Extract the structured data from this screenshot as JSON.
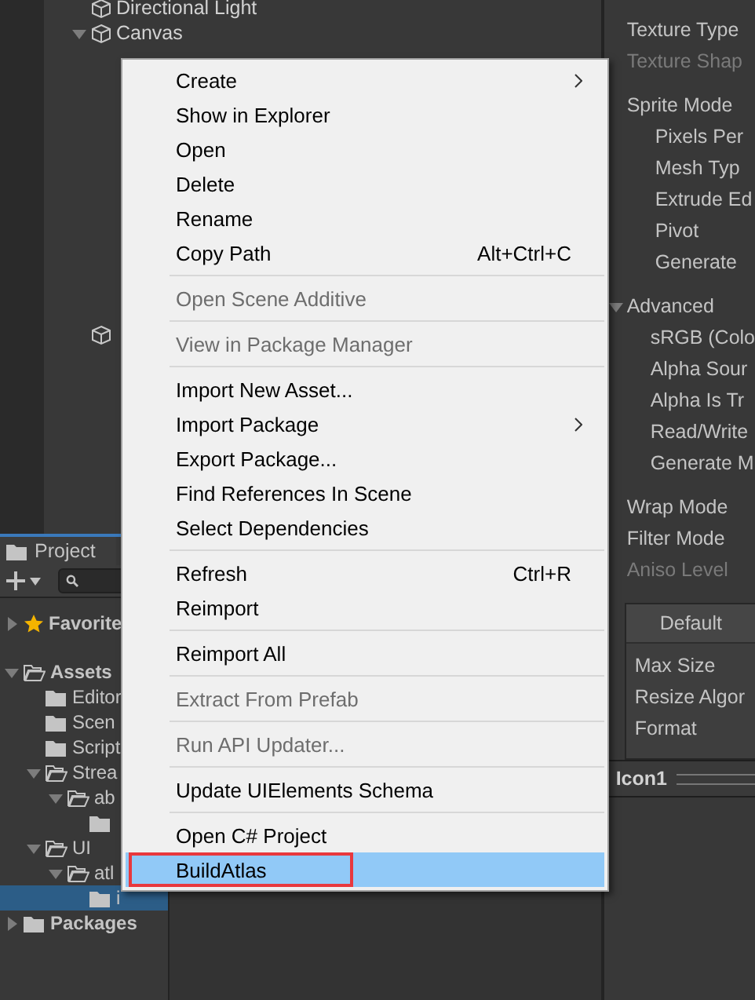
{
  "hierarchy": {
    "items": [
      {
        "kind": "object",
        "name": "Directional Light",
        "selected": false
      },
      {
        "kind": "object",
        "name": "Canvas",
        "selected": false,
        "expanded": true
      },
      {
        "kind": "object",
        "selected": false
      }
    ]
  },
  "project": {
    "tab": "Project",
    "tree": [
      {
        "kind": "favorites",
        "name": "Favorite",
        "expanded": false,
        "selected": false
      },
      {
        "kind": "folder",
        "name": "Assets",
        "expanded": true,
        "selected": false,
        "children": [
          {
            "kind": "folder",
            "name": "Editor",
            "selected": false
          },
          {
            "kind": "folder",
            "name": "Scen",
            "selected": false
          },
          {
            "kind": "folder",
            "name": "Script",
            "selected": false
          },
          {
            "kind": "folder",
            "name": "Strea",
            "expanded": true,
            "selected": false,
            "children": [
              {
                "kind": "folder",
                "name": "ab",
                "expanded": true,
                "selected": false,
                "children": [
                  {
                    "kind": "folder",
                    "selected": false
                  }
                ]
              }
            ]
          },
          {
            "kind": "folder",
            "name": "UI",
            "expanded": true,
            "selected": false,
            "children": [
              {
                "kind": "folder",
                "name": "atl",
                "expanded": true,
                "selected": false,
                "children": [
                  {
                    "kind": "folder",
                    "name": "i",
                    "selected": true
                  }
                ]
              }
            ]
          }
        ]
      },
      {
        "kind": "folder",
        "name": "Packages",
        "expanded": false,
        "selected": false
      }
    ]
  },
  "context_menu": {
    "items": [
      {
        "kind": "item",
        "label": "Create",
        "disabled": false,
        "submenu": true,
        "selected": false,
        "annotated": false
      },
      {
        "kind": "item",
        "label": "Show in Explorer",
        "disabled": false,
        "submenu": false,
        "selected": false,
        "annotated": false
      },
      {
        "kind": "item",
        "label": "Open",
        "disabled": false,
        "submenu": false,
        "selected": false,
        "annotated": false
      },
      {
        "kind": "item",
        "label": "Delete",
        "disabled": false,
        "submenu": false,
        "selected": false,
        "annotated": false
      },
      {
        "kind": "item",
        "label": "Rename",
        "disabled": false,
        "submenu": false,
        "selected": false,
        "annotated": false
      },
      {
        "kind": "item",
        "label": "Copy Path",
        "shortcut": "Alt+Ctrl+C",
        "disabled": false,
        "submenu": false,
        "selected": false,
        "annotated": false
      },
      {
        "kind": "separator"
      },
      {
        "kind": "item",
        "label": "Open Scene Additive",
        "disabled": true,
        "submenu": false,
        "selected": false,
        "annotated": false
      },
      {
        "kind": "separator"
      },
      {
        "kind": "item",
        "label": "View in Package Manager",
        "disabled": true,
        "submenu": false,
        "selected": false,
        "annotated": false
      },
      {
        "kind": "separator"
      },
      {
        "kind": "item",
        "label": "Import New Asset...",
        "disabled": false,
        "submenu": false,
        "selected": false,
        "annotated": false
      },
      {
        "kind": "item",
        "label": "Import Package",
        "disabled": false,
        "submenu": true,
        "selected": false,
        "annotated": false
      },
      {
        "kind": "item",
        "label": "Export Package...",
        "disabled": false,
        "submenu": false,
        "selected": false,
        "annotated": false
      },
      {
        "kind": "item",
        "label": "Find References In Scene",
        "disabled": false,
        "submenu": false,
        "selected": false,
        "annotated": false
      },
      {
        "kind": "item",
        "label": "Select Dependencies",
        "disabled": false,
        "submenu": false,
        "selected": false,
        "annotated": false
      },
      {
        "kind": "separator"
      },
      {
        "kind": "item",
        "label": "Refresh",
        "shortcut": "Ctrl+R",
        "disabled": false,
        "submenu": false,
        "selected": false,
        "annotated": false
      },
      {
        "kind": "item",
        "label": "Reimport",
        "disabled": false,
        "submenu": false,
        "selected": false,
        "annotated": false
      },
      {
        "kind": "separator"
      },
      {
        "kind": "item",
        "label": "Reimport All",
        "disabled": false,
        "submenu": false,
        "selected": false,
        "annotated": false
      },
      {
        "kind": "separator"
      },
      {
        "kind": "item",
        "label": "Extract From Prefab",
        "disabled": true,
        "submenu": false,
        "selected": false,
        "annotated": false
      },
      {
        "kind": "separator"
      },
      {
        "kind": "item",
        "label": "Run API Updater...",
        "disabled": true,
        "submenu": false,
        "selected": false,
        "annotated": false
      },
      {
        "kind": "separator"
      },
      {
        "kind": "item",
        "label": "Update UIElements Schema",
        "disabled": false,
        "submenu": false,
        "selected": false,
        "annotated": false
      },
      {
        "kind": "separator"
      },
      {
        "kind": "item",
        "label": "Open C# Project",
        "disabled": false,
        "submenu": false,
        "selected": false,
        "annotated": false
      },
      {
        "kind": "item",
        "label": "BuildAtlas",
        "disabled": false,
        "submenu": false,
        "selected": true,
        "annotated": true
      }
    ]
  },
  "inspector": {
    "groups": [
      {
        "fields": [
          {
            "label": "Texture Type",
            "disabled": false
          },
          {
            "label": "Texture Shap",
            "disabled": true
          }
        ]
      },
      {
        "fields": [
          {
            "label": "Sprite Mode",
            "disabled": false,
            "children": [
              {
                "label": "Pixels Per",
                "disabled": false
              },
              {
                "label": "Mesh Typ",
                "disabled": false
              },
              {
                "label": "Extrude Ed",
                "disabled": false
              },
              {
                "label": "Pivot",
                "disabled": false
              },
              {
                "label": "Generate",
                "disabled": false
              }
            ]
          }
        ]
      },
      {
        "fields": [
          {
            "label": "Advanced",
            "disabled": false,
            "expanded": true,
            "children": [
              {
                "label": "sRGB (Colo",
                "disabled": false
              },
              {
                "label": "Alpha Sour",
                "disabled": false
              },
              {
                "label": "Alpha Is Tr",
                "disabled": false
              },
              {
                "label": "Read/Write",
                "disabled": false
              },
              {
                "label": "Generate M",
                "disabled": false
              }
            ]
          }
        ]
      },
      {
        "fields": [
          {
            "label": "Wrap Mode",
            "disabled": false
          },
          {
            "label": "Filter Mode",
            "disabled": false
          },
          {
            "label": "Aniso Level",
            "disabled": true
          }
        ]
      }
    ],
    "platform_box": {
      "tabs": [
        {
          "label": "Default",
          "selected": true
        }
      ],
      "fields": [
        "Max Size",
        "Resize Algor",
        "Format"
      ]
    },
    "asset_bar": {
      "title": "Icon1"
    }
  }
}
